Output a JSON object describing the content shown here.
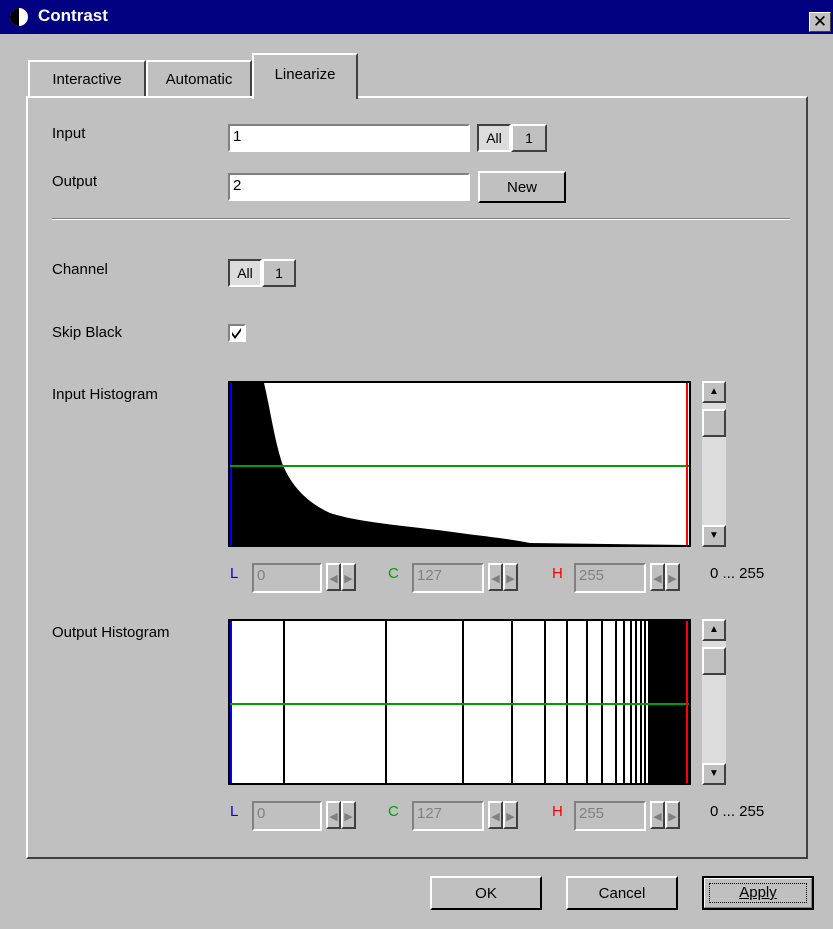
{
  "window": {
    "title": "Contrast",
    "close_glyph": "✕"
  },
  "tabs": [
    {
      "label": "Interactive"
    },
    {
      "label": "Automatic"
    },
    {
      "label": "Linearize"
    }
  ],
  "linearize": {
    "input_label": "Input",
    "input_value": "1",
    "input_all": "All",
    "input_one": "1",
    "output_label": "Output",
    "output_value": "2",
    "new_button": "New",
    "channel_label": "Channel",
    "channel_all": "All",
    "channel_one": "1",
    "skip_black_label": "Skip Black",
    "skip_black_checked": true,
    "input_histogram_label": "Input Histogram",
    "output_histogram_label": "Output Histogram"
  },
  "input_histogram": {
    "l_label": "L",
    "l_value": "0",
    "c_label": "C",
    "c_value": "127",
    "h_label": "H",
    "h_value": "255",
    "range": "0 ... 255"
  },
  "output_histogram": {
    "l_label": "L",
    "l_value": "0",
    "c_label": "C",
    "c_value": "127",
    "h_label": "H",
    "h_value": "255",
    "range": "0 ... 255"
  },
  "buttons": {
    "ok": "OK",
    "cancel": "Cancel",
    "apply": "Apply"
  },
  "colors": {
    "low": "#0000ff",
    "center": "#00a000",
    "high": "#ff0000",
    "title": "#000080"
  }
}
